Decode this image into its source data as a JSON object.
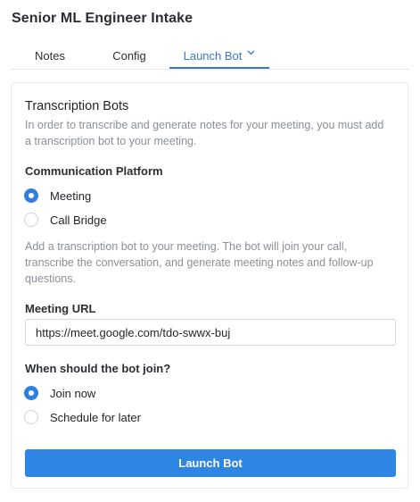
{
  "page": {
    "title": "Senior ML Engineer Intake"
  },
  "tabs": [
    {
      "label": "Notes"
    },
    {
      "label": "Config"
    },
    {
      "label": "Launch Bot",
      "active": true
    }
  ],
  "colors": {
    "accent": "#2f86e2",
    "muted_text": "#8a9096",
    "active_tab": "#3a78c6"
  },
  "bot_panel": {
    "title": "Transcription Bots",
    "intro": "In order to transcribe and generate notes for your meeting, you must add a transcription bot to your meeting.",
    "platform": {
      "label": "Communication Platform",
      "options": [
        {
          "label": "Meeting",
          "checked": true
        },
        {
          "label": "Call Bridge",
          "checked": false
        }
      ]
    },
    "info": "Add a transcription bot to your meeting. The bot will join your call, transcribe the conversation, and generate meeting notes and follow-up questions.",
    "meeting_url": {
      "label": "Meeting URL",
      "value": "https://meet.google.com/tdo-swwx-buj"
    },
    "join": {
      "label": "When should the bot join?",
      "options": [
        {
          "label": "Join now",
          "checked": true
        },
        {
          "label": "Schedule for later",
          "checked": false
        }
      ]
    },
    "launch_label": "Launch Bot"
  }
}
